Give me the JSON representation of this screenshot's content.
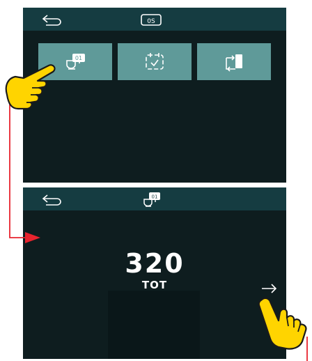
{
  "screen_top": {
    "topbar": {
      "back_icon": "back-arrow-icon",
      "title_icon": "program-counter-icon",
      "title_text": "0S"
    },
    "tiles": [
      {
        "icon": "counter-machine-icon",
        "badge": "01"
      },
      {
        "icon": "calendar-check-icon"
      },
      {
        "icon": "transfer-exchange-icon"
      }
    ]
  },
  "screen_bottom": {
    "topbar": {
      "back_icon": "back-arrow-icon",
      "title_icon": "counter-machine-icon",
      "badge": "01"
    },
    "counter": {
      "value": "320",
      "label": "TOT"
    },
    "next_icon": "right-arrow-icon"
  },
  "annotations": {
    "pointer_color": "#e8242e",
    "hand_color": "#ffd400"
  },
  "colors": {
    "screen_bg": "#0e1d1f",
    "topbar_bg": "#153c41",
    "tile_bg": "#5f9a99"
  }
}
